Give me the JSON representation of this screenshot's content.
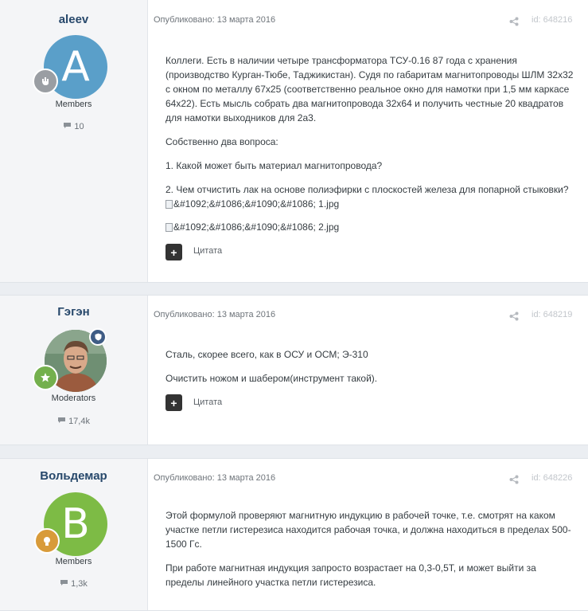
{
  "posts": [
    {
      "author": "aleev",
      "avatar_letter": "A",
      "avatar_color": "#5a9fc9",
      "group": "Members",
      "count": "10",
      "published": "Опубликовано: 13 марта 2016",
      "post_id": "id: 648216",
      "paragraphs": [
        "Коллеги. Есть в наличии четыре трансформатора ТСУ-0.16 87 года с хранения (производство Курган-Тюбе, Таджикистан). Судя по габаритам магнитопроводы ШЛМ 32х32 с окном по металлу 67х25 (соответственно реальное окно для намотки при 1,5 мм каркасе 64х22). Есть мысль собрать два магнитопровода 32х64 и получить честные 20 квадратов для намотки выходников для 2а3.",
        "Собственно два вопроса:",
        "1. Какой может быть материал магнитопровода?",
        "2. Чем отчистить лак на основе полиэфирки с плоскостей железа для попарной стыковки?"
      ],
      "images": [
        "&#1092;&#1086;&#1090;&#1086; 1.jpg",
        "&#1092;&#1086;&#1090;&#1086; 2.jpg"
      ],
      "quote_label": "Цитата"
    },
    {
      "author": "Гэгэн",
      "group": "Moderators",
      "count": "17,4k",
      "published": "Опубликовано: 13 марта 2016",
      "post_id": "id: 648219",
      "paragraphs": [
        "Сталь, скорее всего, как в ОСУ и ОСМ; Э-310",
        "Очистить ножом и шабером(инструмент такой)."
      ],
      "quote_label": "Цитата"
    },
    {
      "author": "Вольдемар",
      "avatar_letter": "B",
      "avatar_color": "#7dbb45",
      "group": "Members",
      "count": "1,3k",
      "published": "Опубликовано: 13 марта 2016",
      "post_id": "id: 648226",
      "paragraphs": [
        "Этой формулой проверяют магнитную индукцию в рабочей точке, т.е. смотрят на каком участке петли гистерезиса находится рабочая точка, и должна находиться в пределах 500-1500 Гс.",
        "При работе магнитная индукция запросто возрастает на 0,3-0,5Т, и может выйти за пределы линейного участка петли гистерезиса."
      ]
    }
  ]
}
